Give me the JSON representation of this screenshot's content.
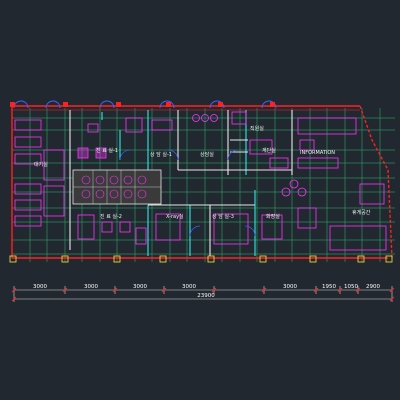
{
  "drawing": {
    "background": "#212830",
    "colors": {
      "wall_red": "#ff2020",
      "furniture_magenta": "#ff33ff",
      "grid_green": "#2fd17a",
      "partition_cyan": "#32e6e6",
      "partition_white": "#e8e8e8",
      "column_yellow": "#e6d23c",
      "door_blue": "#3c64ff",
      "dim_line": "#d8d8d8"
    },
    "room_labels": {
      "treatment_1": "진 료 실-1",
      "waiting": "대기실",
      "consult_1": "상 담 실-1",
      "consult_2": "상담실",
      "xray": "X-ray실",
      "staff": "직원실",
      "stairs": "계단실",
      "information": "INFORMATION",
      "treatment_2": "진 료 실-2",
      "consult_3": "상 담 실-3",
      "toilet": "화장실",
      "lounge": "휴게공간"
    },
    "dimensions": {
      "segments": [
        "3000",
        "3000",
        "3000",
        "3000",
        "3000",
        "1950",
        "1050",
        "2900"
      ],
      "total": "23900"
    }
  }
}
